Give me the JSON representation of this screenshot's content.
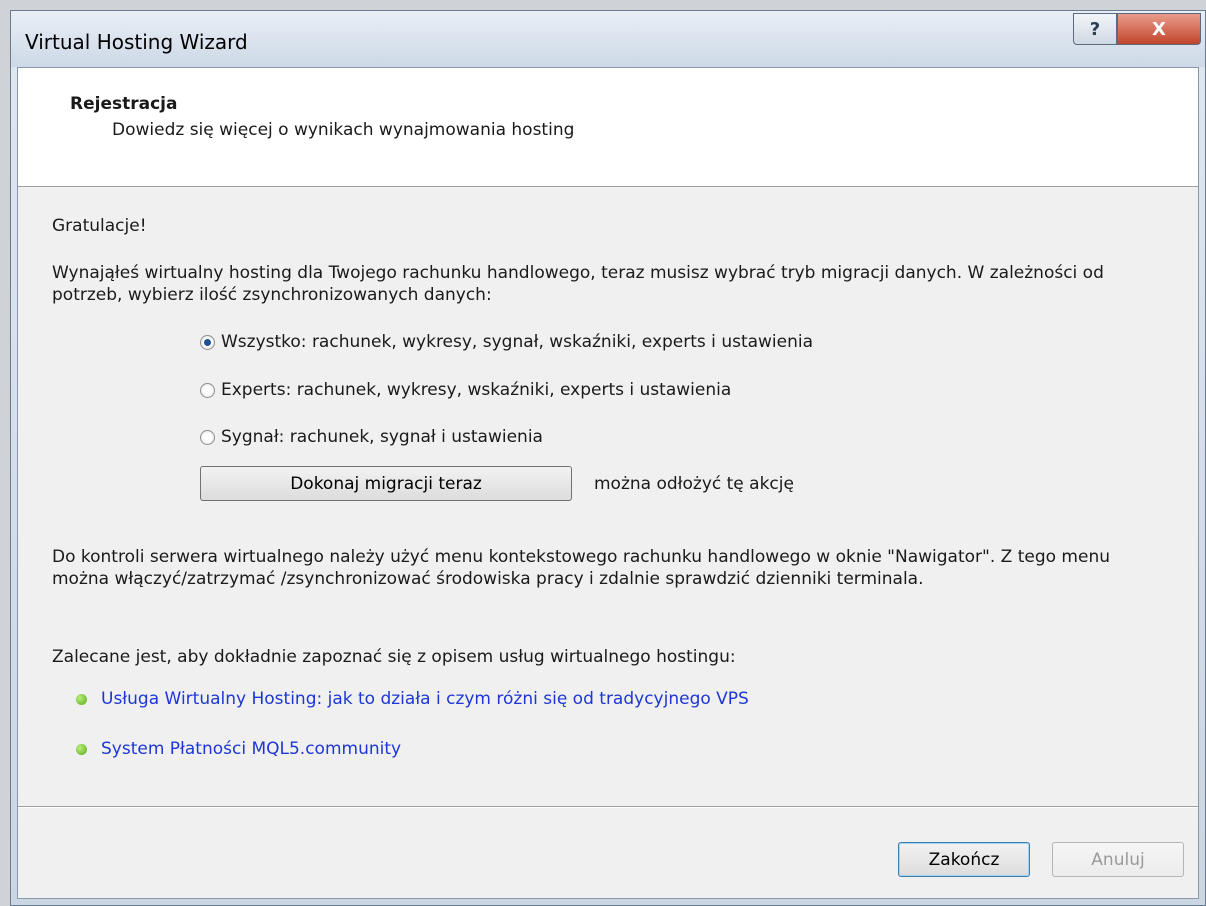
{
  "window": {
    "title": "Virtual Hosting Wizard",
    "help_glyph": "?",
    "close_glyph": "X"
  },
  "header": {
    "title": "Rejestracja",
    "subtitle": "Dowiedz się więcej o wynikach wynajmowania hosting"
  },
  "body": {
    "greeting": "Gratulacje!",
    "intro_line1": "Wynająłeś wirtualny hosting dla Twojego rachunku handlowego, teraz musisz wybrać tryb migracji danych. W zależności od",
    "intro_line2": "potrzeb, wybierz ilość zsynchronizowanych danych:",
    "options": [
      {
        "label": "Wszystko: rachunek, wykresy, sygnał, wskaźniki, experts i ustawienia",
        "selected": true
      },
      {
        "label": "Experts: rachunek, wykresy, wskaźniki, experts i ustawienia",
        "selected": false
      },
      {
        "label": "Sygnał: rachunek, sygnał i ustawienia",
        "selected": false
      }
    ],
    "migrate_button": "Dokonaj migracji teraz",
    "migrate_note": "można odłożyć tę akcję",
    "control_line1": "Do kontroli  serwera wirtualnego należy użyć menu kontekstowego rachunku handlowego w oknie \"Nawigator\". Z tego menu",
    "control_line2": "można włączyć/zatrzymać /zsynchronizować środowiska pracy i zdalnie sprawdzić dzienniki terminala.",
    "recommend": "Zalecane jest, aby dokładnie zapoznać się z opisem usług wirtualnego hostingu:",
    "links": [
      {
        "label": "Usługa Wirtualny Hosting: jak to działa i czym różni się od tradycyjnego VPS"
      },
      {
        "label": "System Płatności MQL5.community"
      }
    ]
  },
  "footer": {
    "finish_button": "Zakończ",
    "cancel_button": "Anuluj"
  },
  "colors": {
    "link": "#1d37d4",
    "bullet": "#5aa81e",
    "close_button": "#c2452d"
  }
}
